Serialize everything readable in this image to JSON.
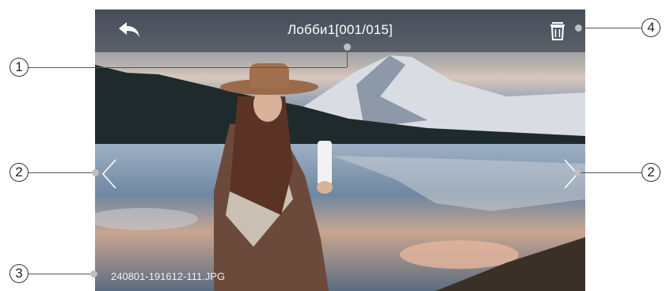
{
  "viewer": {
    "title": "Лобби1[001/015]",
    "filename": "240801-191612-111.JPG",
    "icons": {
      "back": "back-arrow-icon",
      "delete": "trash-icon",
      "previous": "chevron-left-icon",
      "next": "chevron-right-icon"
    }
  },
  "callouts": {
    "title_marker": "1",
    "prev_marker": "2",
    "next_marker": "2",
    "filename_marker": "3",
    "delete_marker": "4"
  },
  "colors": {
    "overlay": "#282c34",
    "text": "#ffffff",
    "callout_line": "#555555"
  }
}
